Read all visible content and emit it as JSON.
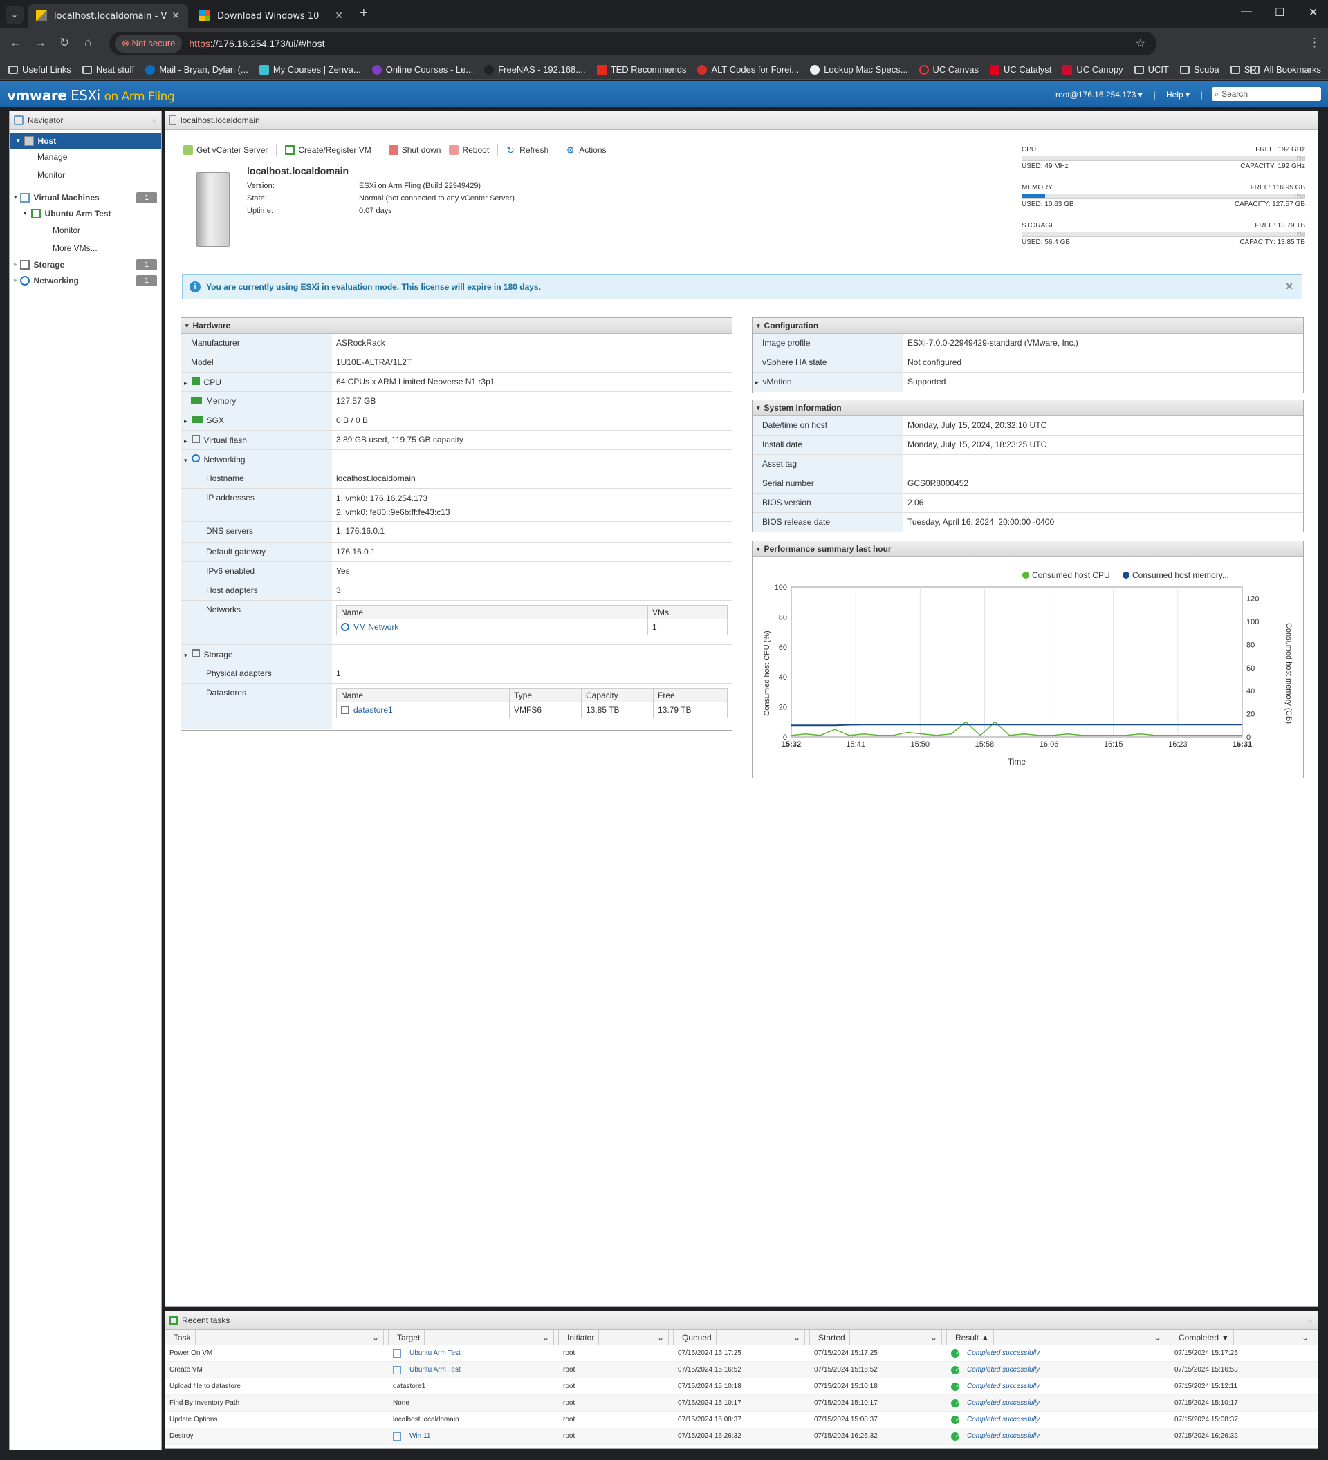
{
  "browser": {
    "tabs": [
      {
        "title": "localhost.localdomain - VMware",
        "active": true
      },
      {
        "title": "Download Windows 10",
        "active": false
      }
    ],
    "not_secure": "Not secure",
    "url_scheme": "https",
    "url_rest": "://176.16.254.173/ui/#/host",
    "bookmarks": [
      "Useful Links",
      "Neat stuff",
      "Mail - Bryan, Dylan (...",
      "My Courses | Zenva...",
      "Online Courses - Le...",
      "FreeNAS - 192.168....",
      "TED Recommends",
      "ALT Codes for Forei...",
      "Lookup Mac Specs...",
      "UC Canvas",
      "UC Catalyst",
      "UC Canopy",
      "UCIT",
      "Scuba",
      "SR"
    ],
    "all_bookmarks": "All Bookmarks"
  },
  "header": {
    "logo_vm": "vmware",
    "logo_esxi": "ESXi",
    "logo_fling": "on Arm Fling",
    "user": "root@176.16.254.173 ▾",
    "help": "Help ▾",
    "search_placeholder": "Search"
  },
  "navigator": {
    "title": "Navigator",
    "host": "Host",
    "manage": "Manage",
    "monitor": "Monitor",
    "virtual_machines": "Virtual Machines",
    "vm_count": "1",
    "vm_name": "Ubuntu Arm Test",
    "vm_monitor": "Monitor",
    "more_vms": "More VMs...",
    "storage": "Storage",
    "storage_count": "1",
    "networking": "Networking",
    "networking_count": "1"
  },
  "main": {
    "title": "localhost.localdomain",
    "actions": [
      "Get vCenter Server",
      "Create/Register VM",
      "Shut down",
      "Reboot",
      "Refresh",
      "Actions"
    ],
    "host_name": "localhost.localdomain",
    "version_label": "Version:",
    "version": "ESXi on Arm Fling (Build 22949429)",
    "state_label": "State:",
    "state": "Normal (not connected to any vCenter Server)",
    "uptime_label": "Uptime:",
    "uptime": "0.07 days"
  },
  "resources": {
    "cpu": {
      "label": "CPU",
      "free": "FREE: 192 GHz",
      "pct": "0%",
      "pct_value": 0,
      "used": "USED: 49 MHz",
      "capacity": "CAPACITY: 192 GHz"
    },
    "memory": {
      "label": "MEMORY",
      "free": "FREE: 116.95 GB",
      "pct": "8%",
      "pct_value": 8,
      "used": "USED: 10.63 GB",
      "capacity": "CAPACITY: 127.57 GB"
    },
    "storage": {
      "label": "STORAGE",
      "free": "FREE: 13.79 TB",
      "pct": "0%",
      "pct_value": 0,
      "used": "USED: 56.4 GB",
      "capacity": "CAPACITY: 13.85 TB"
    }
  },
  "alert": "You are currently using ESXi in evaluation mode. This license will expire in 180 days.",
  "hardware": {
    "title": "Hardware",
    "rows": [
      {
        "k": "Manufacturer",
        "v": "ASRockRack"
      },
      {
        "k": "Model",
        "v": "1U10E-ALTRA/1L2T"
      },
      {
        "k": "CPU",
        "v": "64 CPUs x ARM Limited Neoverse N1 r3p1"
      },
      {
        "k": "Memory",
        "v": "127.57 GB"
      },
      {
        "k": "SGX",
        "v": "0 B / 0 B"
      },
      {
        "k": "Virtual flash",
        "v": "3.89 GB used, 119.75 GB capacity"
      },
      {
        "k": "Networking",
        "v": ""
      }
    ],
    "net": [
      {
        "k": "Hostname",
        "v": "localhost.localdomain"
      },
      {
        "k": "IP addresses",
        "v": "1. vmk0: 176.16.254.173",
        "v2": "2. vmk0: fe80::9e6b:ff:fe43:c13"
      },
      {
        "k": "DNS servers",
        "v": "1. 176.16.0.1"
      },
      {
        "k": "Default gateway",
        "v": "176.16.0.1"
      },
      {
        "k": "IPv6 enabled",
        "v": "Yes"
      },
      {
        "k": "Host adapters",
        "v": "3"
      },
      {
        "k": "Networks",
        "v": ""
      }
    ],
    "networks_table": {
      "h_name": "Name",
      "h_vms": "VMs",
      "name": "VM Network",
      "vms": "1"
    },
    "storage_label": "Storage",
    "physical_adapters_k": "Physical adapters",
    "physical_adapters_v": "1",
    "datastores_k": "Datastores",
    "ds_table": {
      "h_name": "Name",
      "h_type": "Type",
      "h_cap": "Capacity",
      "h_free": "Free",
      "name": "datastore1",
      "type": "VMFS6",
      "cap": "13.85 TB",
      "free": "13.79 TB"
    }
  },
  "configuration": {
    "title": "Configuration",
    "rows": [
      {
        "k": "Image profile",
        "v": "ESXi-7.0.0-22949429-standard (VMware, Inc.)"
      },
      {
        "k": "vSphere HA state",
        "v": "Not configured"
      },
      {
        "k": "vMotion",
        "v": "Supported"
      }
    ]
  },
  "system_info": {
    "title": "System Information",
    "rows": [
      {
        "k": "Date/time on host",
        "v": "Monday, July 15, 2024, 20:32:10 UTC"
      },
      {
        "k": "Install date",
        "v": "Monday, July 15, 2024, 18:23:25 UTC"
      },
      {
        "k": "Asset tag",
        "v": ""
      },
      {
        "k": "Serial number",
        "v": "GCS0R8000452"
      },
      {
        "k": "BIOS version",
        "v": "2.06"
      },
      {
        "k": "BIOS release date",
        "v": "Tuesday, April 16, 2024, 20:00:00 -0400"
      }
    ]
  },
  "performance": {
    "title": "Performance summary last hour",
    "legend_cpu": "Consumed host CPU",
    "legend_mem": "Consumed host memory...",
    "ylabel_left": "Consumed host CPU (%)",
    "ylabel_right": "Consumed host memory (GB)",
    "xlabel": "Time"
  },
  "chart_data": {
    "type": "line",
    "x": [
      "15:32",
      "15:41",
      "15:50",
      "15:58",
      "16:06",
      "16:15",
      "16:23",
      "16:31"
    ],
    "ylim_left": [
      0,
      100
    ],
    "ylim_right": [
      0,
      130
    ],
    "yticks_left": [
      0,
      20,
      40,
      60,
      80,
      100
    ],
    "yticks_right": [
      0,
      20,
      40,
      60,
      80,
      100,
      120
    ],
    "grid": true,
    "legend": "top-right",
    "series": [
      {
        "name": "Consumed host CPU",
        "color": "#5cb832",
        "axis": "left",
        "values": [
          1,
          2,
          1,
          5,
          1,
          2,
          1,
          1,
          3,
          2,
          1,
          2,
          10,
          1,
          10,
          1,
          2,
          1,
          1,
          2,
          1,
          1,
          1,
          1,
          2,
          1,
          1,
          1,
          1,
          1,
          1,
          1
        ]
      },
      {
        "name": "Consumed host memory...",
        "color": "#1a4b8a",
        "axis": "right",
        "values": [
          10,
          10,
          10,
          10,
          10.5,
          10.6,
          10.6,
          10.6,
          10.6,
          10.6,
          10.6,
          10.6,
          10.6,
          10.6,
          10.6,
          10.6,
          10.6,
          10.6,
          10.6,
          10.6,
          10.6,
          10.6,
          10.6,
          10.6,
          10.6,
          10.6,
          10.6,
          10.6,
          10.6,
          10.6,
          10.6,
          10.6
        ]
      }
    ]
  },
  "recent_tasks": {
    "title": "Recent tasks",
    "columns": [
      "Task",
      "Target",
      "Initiator",
      "Queued",
      "Started",
      "Result ▲",
      "Completed ▼"
    ],
    "rows": [
      [
        "Power On VM",
        "Ubuntu Arm Test",
        "root",
        "07/15/2024 15:17:25",
        "07/15/2024 15:17:25",
        "Completed successfully",
        "07/15/2024 15:17:25"
      ],
      [
        "Create VM",
        "Ubuntu Arm Test",
        "root",
        "07/15/2024 15:16:52",
        "07/15/2024 15:16:52",
        "Completed successfully",
        "07/15/2024 15:16:53"
      ],
      [
        "Upload file to datastore",
        "datastore1",
        "root",
        "07/15/2024 15:10:18",
        "07/15/2024 15:10:18",
        "Completed successfully",
        "07/15/2024 15:12:11"
      ],
      [
        "Find By Inventory Path",
        "None",
        "root",
        "07/15/2024 15:10:17",
        "07/15/2024 15:10:17",
        "Completed successfully",
        "07/15/2024 15:10:17"
      ],
      [
        "Update Options",
        "localhost.localdomain",
        "root",
        "07/15/2024 15:08:37",
        "07/15/2024 15:08:37",
        "Completed successfully",
        "07/15/2024 15:08:37"
      ],
      [
        "Destroy",
        "Win 11",
        "root",
        "07/15/2024 16:26:32",
        "07/15/2024 16:26:32",
        "Completed successfully",
        "07/15/2024 16:26:32"
      ]
    ]
  }
}
